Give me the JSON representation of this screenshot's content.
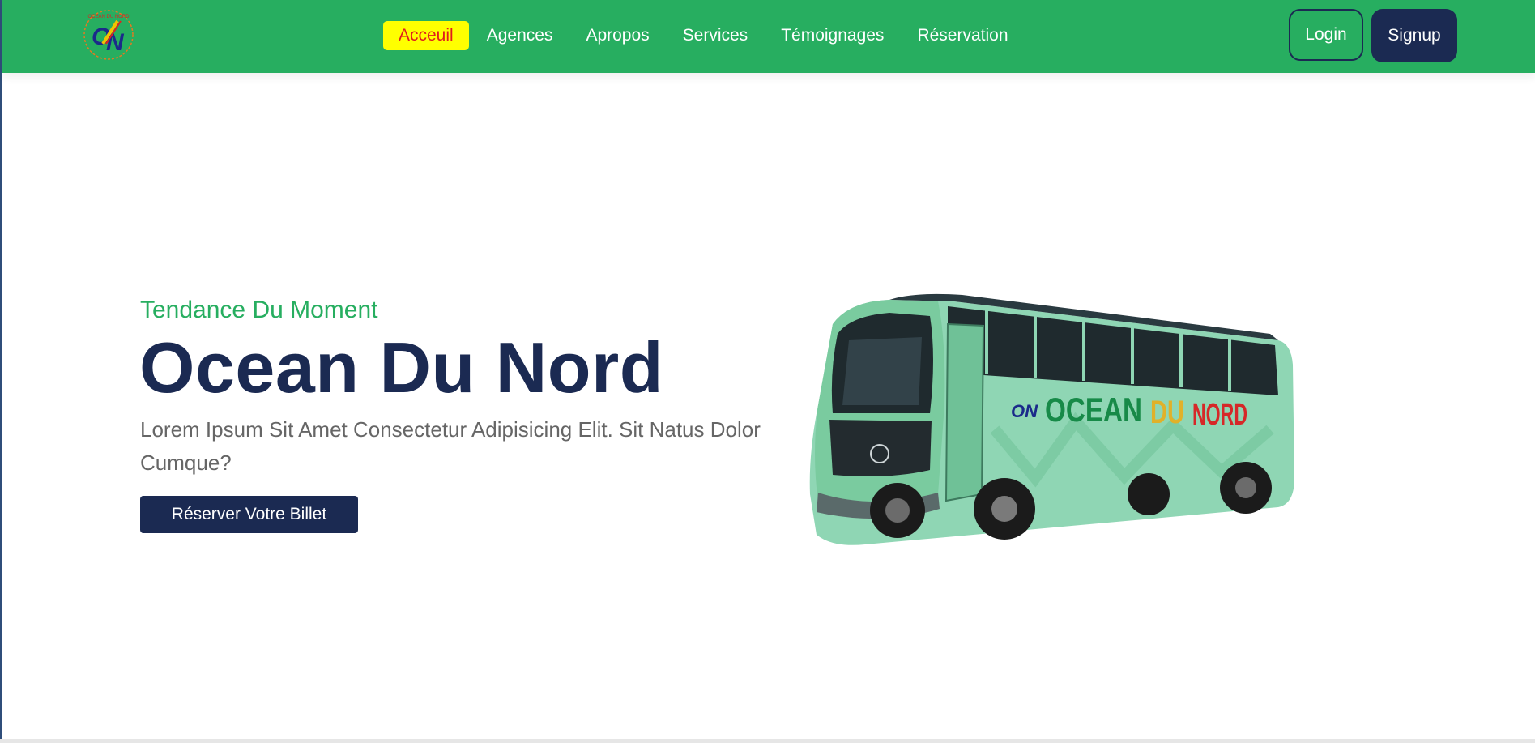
{
  "nav": {
    "logo_alt": "OCEAN DU NORD",
    "logo_text": "ON",
    "links": [
      {
        "label": "Acceuil",
        "active": true
      },
      {
        "label": "Agences"
      },
      {
        "label": "Apropos"
      },
      {
        "label": "Services"
      },
      {
        "label": "Témoignages"
      },
      {
        "label": "Réservation"
      }
    ],
    "login_label": "Login",
    "signup_label": "Signup"
  },
  "hero": {
    "subtitle": "Tendance Du Moment",
    "title": "Ocean Du Nord",
    "description": "Lorem Ipsum Sit Amet Consectetur Adipisicing Elit. Sit Natus Dolor Cumque?",
    "cta_label": "Réserver Votre Billet",
    "bus_branding": {
      "word1": "OCEAN",
      "word2": "DU",
      "word3": "NORD",
      "logo": "ON"
    }
  },
  "colors": {
    "brand_green": "#27ae60",
    "navy": "#1b2a52",
    "active_highlight": "#ffff00",
    "active_text": "#e01d1d",
    "body_text": "#666666"
  }
}
